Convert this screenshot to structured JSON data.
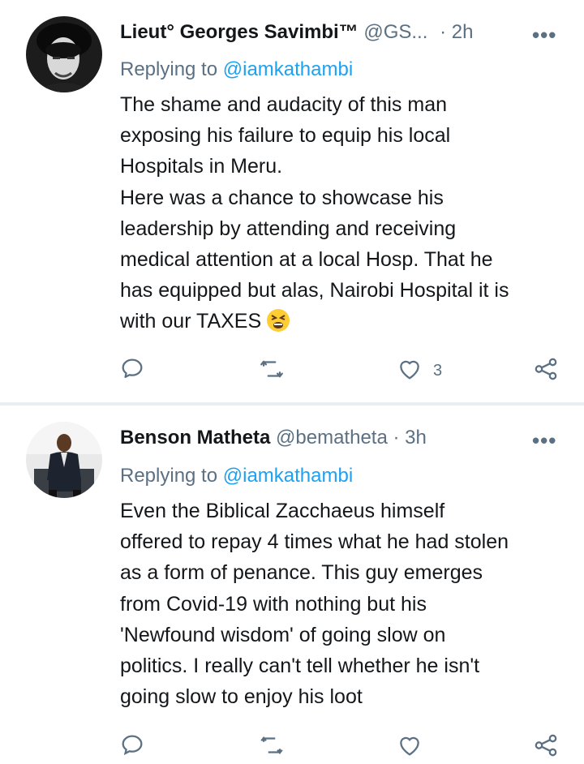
{
  "tweets": [
    {
      "name": "Lieut° Georges Savimbi™",
      "handle": "@GS...",
      "time": "· 2h",
      "more": "•••",
      "reply_prefix": "Replying to",
      "reply_to": "@iamkathambi",
      "lines": [
        "The shame and audacity of this man",
        "exposing his failure to equip his local",
        "Hospitals in Meru.",
        "Here was a chance to showcase his",
        "leadership by attending and receiving",
        "medical attention at a local Hosp. That he",
        "has equipped but alas, Nairobi Hospital it is",
        "with our TAXES"
      ],
      "emoji_icon": "tired-face-emoji",
      "like_count": "3"
    },
    {
      "name": "Benson Matheta",
      "handle": "@bematheta",
      "time": "· 3h",
      "more": "•••",
      "reply_prefix": "Replying to",
      "reply_to": "@iamkathambi",
      "lines": [
        "Even the Biblical Zacchaeus himself",
        "offered to repay 4 times what he had stolen",
        "as a form of penance. This guy emerges",
        "from Covid-19 with nothing but his",
        "'Newfound wisdom' of going slow on",
        "politics. I really can't tell whether he isn't",
        "going slow to enjoy his loot"
      ]
    }
  ],
  "colors": {
    "text": "#14171a",
    "secondary": "#5b7083",
    "link": "#1da1f2",
    "divider": "#ebeef0"
  },
  "icons": [
    "comment-icon",
    "retweet-icon",
    "heart-icon",
    "share-icon",
    "more-icon"
  ]
}
